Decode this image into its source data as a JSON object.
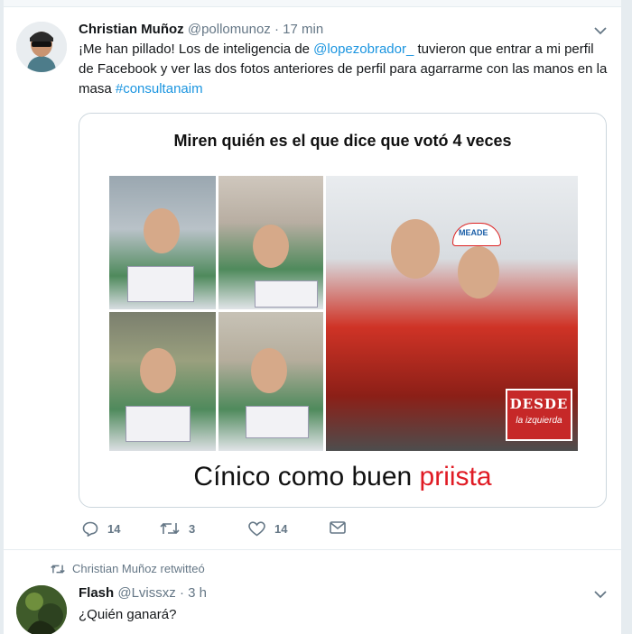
{
  "tweet1": {
    "name": "Christian Muñoz",
    "handle": "@pollomunoz",
    "separator": "·",
    "time": "17 min",
    "text_before": "¡Me han pillado! Los de inteligencia de ",
    "mention": "@lopezobrador_",
    "text_middle": "  tuvieron que entrar a mi perfil de Facebook y ver las dos fotos anteriores de perfil para agarrarme con las manos en la masa ",
    "hashtag": "#consultanaim",
    "meme": {
      "title": "Miren quién es el que dice que votó 4 veces",
      "badge_line1": "DESDE",
      "badge_line2": "la izquierda",
      "cap_text": "MEADE",
      "caption_black": "Cínico como buen ",
      "caption_red": "priista"
    },
    "actions": {
      "replies": "14",
      "retweets": "3",
      "likes": "14"
    }
  },
  "tweet2": {
    "retweet_context": "Christian Muñoz retwitteó",
    "name": "Flash",
    "handle": "@Lvissxz",
    "separator": "·",
    "time": "3 h",
    "text": "¿Quién ganará?"
  },
  "colors": {
    "link": "#1b95e0",
    "muted": "#657786",
    "text": "#14171a",
    "border": "#e6ecf0",
    "caption_red": "#e01b24"
  },
  "icons": [
    "reply-icon",
    "retweet-icon",
    "like-icon",
    "direct-message-icon",
    "caret-down-icon"
  ]
}
